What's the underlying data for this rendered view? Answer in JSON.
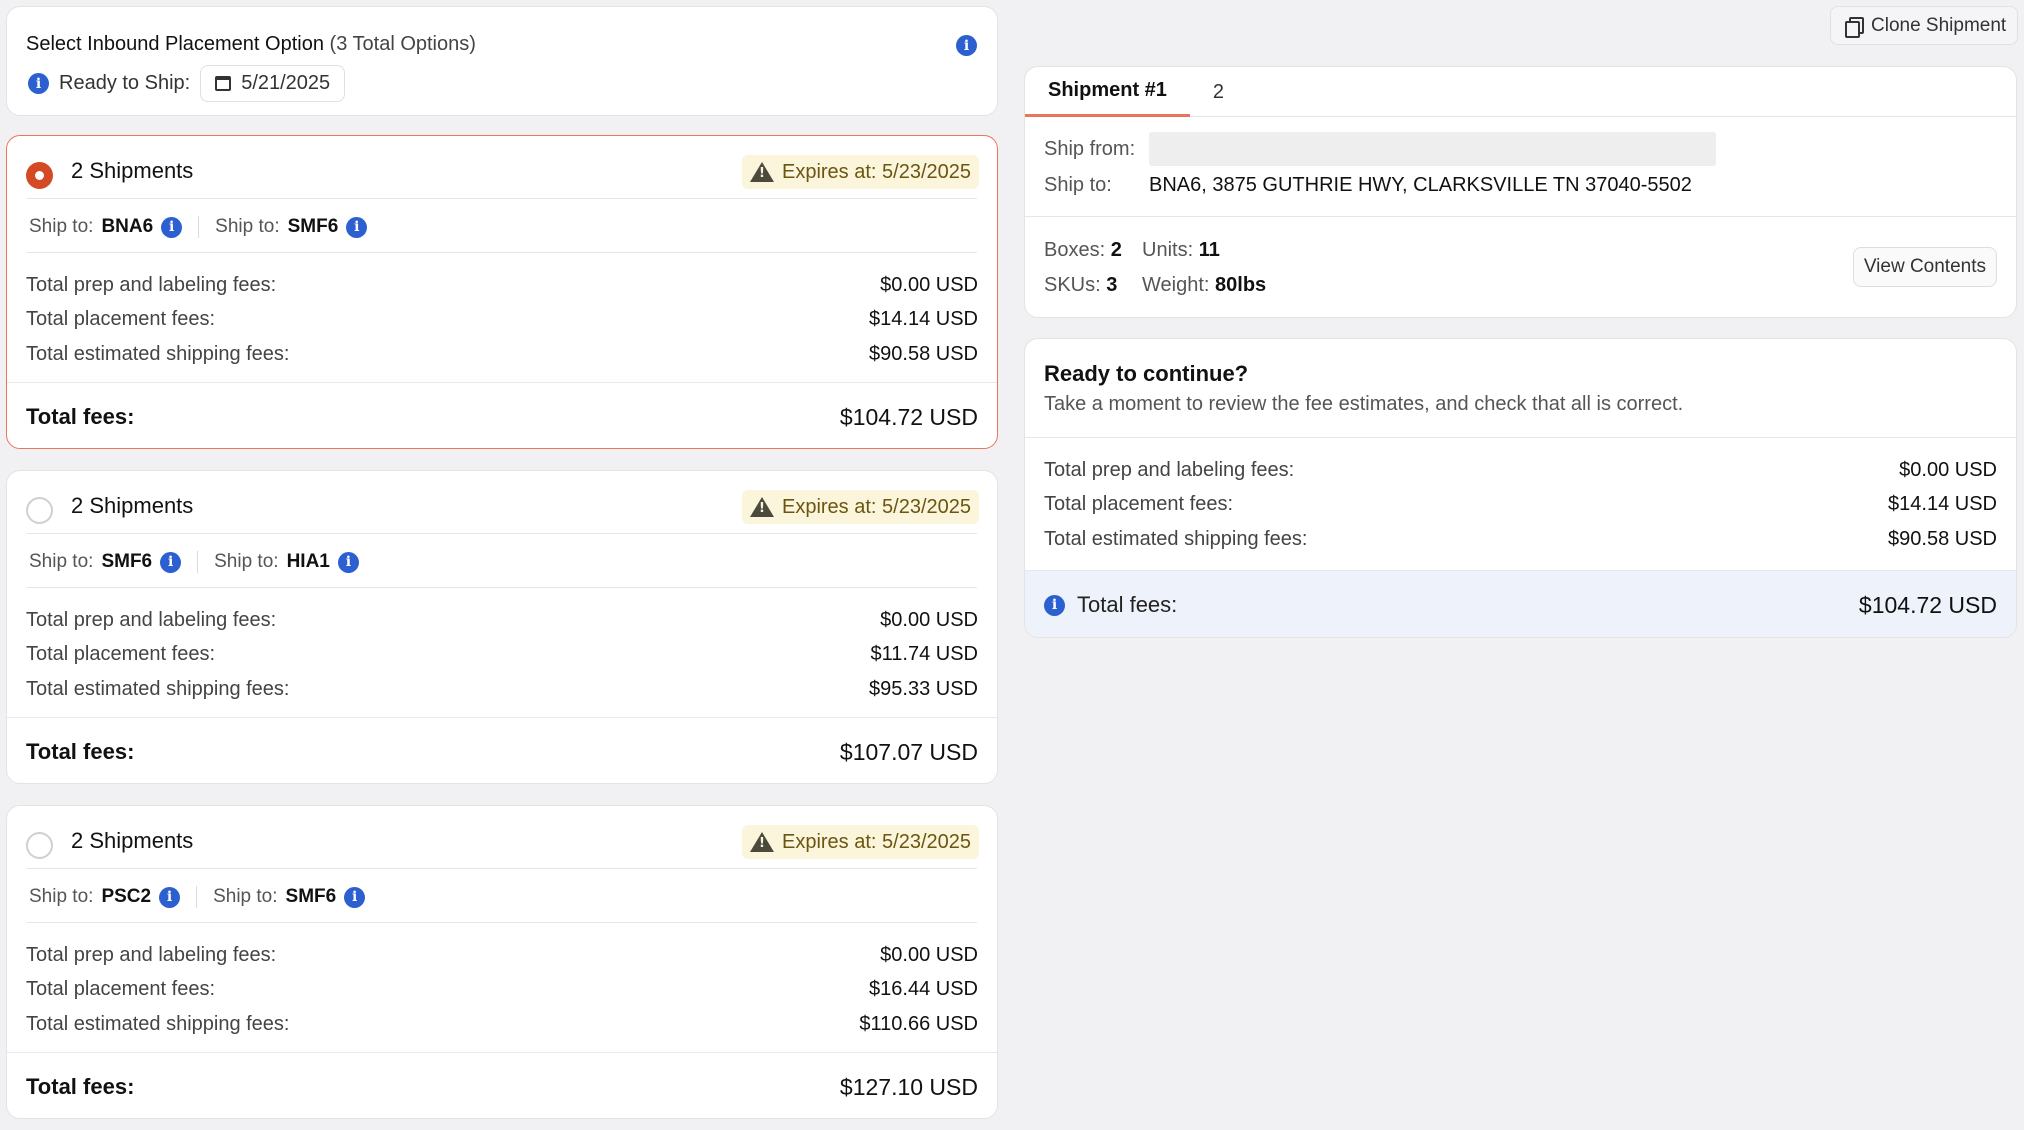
{
  "header": {
    "title": "Select Inbound Placement Option",
    "subtitle": "(3 Total Options)",
    "ready_label": "Ready to Ship:",
    "ready_date": "5/21/2025"
  },
  "options": [
    {
      "title": "2 Shipments",
      "expires": "Expires at: 5/23/2025",
      "selected": true,
      "ship_to": [
        {
          "label": "Ship to:",
          "code": "BNA6"
        },
        {
          "label": "Ship to:",
          "code": "SMF6"
        }
      ],
      "fees": [
        {
          "label": "Total prep and labeling fees:",
          "value": "$0.00 USD"
        },
        {
          "label": "Total placement fees:",
          "value": "$14.14 USD"
        },
        {
          "label": "Total estimated shipping fees:",
          "value": "$90.58 USD"
        }
      ],
      "total_label": "Total fees:",
      "total_value": "$104.72 USD"
    },
    {
      "title": "2 Shipments",
      "expires": "Expires at: 5/23/2025",
      "selected": false,
      "ship_to": [
        {
          "label": "Ship to:",
          "code": "SMF6"
        },
        {
          "label": "Ship to:",
          "code": "HIA1"
        }
      ],
      "fees": [
        {
          "label": "Total prep and labeling fees:",
          "value": "$0.00 USD"
        },
        {
          "label": "Total placement fees:",
          "value": "$11.74 USD"
        },
        {
          "label": "Total estimated shipping fees:",
          "value": "$95.33 USD"
        }
      ],
      "total_label": "Total fees:",
      "total_value": "$107.07 USD"
    },
    {
      "title": "2 Shipments",
      "expires": "Expires at: 5/23/2025",
      "selected": false,
      "ship_to": [
        {
          "label": "Ship to:",
          "code": "PSC2"
        },
        {
          "label": "Ship to:",
          "code": "SMF6"
        }
      ],
      "fees": [
        {
          "label": "Total prep and labeling fees:",
          "value": "$0.00 USD"
        },
        {
          "label": "Total placement fees:",
          "value": "$16.44 USD"
        },
        {
          "label": "Total estimated shipping fees:",
          "value": "$110.66 USD"
        }
      ],
      "total_label": "Total fees:",
      "total_value": "$127.10 USD"
    }
  ],
  "clone_button": "Clone Shipment",
  "shipment": {
    "tabs": [
      "Shipment #1",
      "2"
    ],
    "ship_from_label": "Ship from:",
    "ship_to_label": "Ship to:",
    "ship_to_address": "BNA6, 3875 GUTHRIE HWY, CLARKSVILLE TN 37040-5502",
    "boxes_label": "Boxes:",
    "boxes": "2",
    "units_label": "Units:",
    "units": "11",
    "skus_label": "SKUs:",
    "skus": "3",
    "weight_label": "Weight:",
    "weight": "80lbs",
    "view_contents": "View Contents"
  },
  "summary": {
    "title": "Ready to continue?",
    "subtitle": "Take a moment to review the fee estimates, and check that all is correct.",
    "fees": [
      {
        "label": "Total prep and labeling fees:",
        "value": "$0.00 USD"
      },
      {
        "label": "Total placement fees:",
        "value": "$14.14 USD"
      },
      {
        "label": "Total estimated shipping fees:",
        "value": "$90.58 USD"
      }
    ],
    "total_label": "Total fees:",
    "total_value": "$104.72 USD"
  },
  "colors": {
    "accent": "#d44a25",
    "info": "#2c5fd0",
    "warning_bg": "#fbf5dc",
    "summary_total_bg": "#eef2fb"
  },
  "icons": [
    "info-icon",
    "calendar-icon",
    "warning-icon",
    "clone-icon",
    "radio-icon"
  ]
}
